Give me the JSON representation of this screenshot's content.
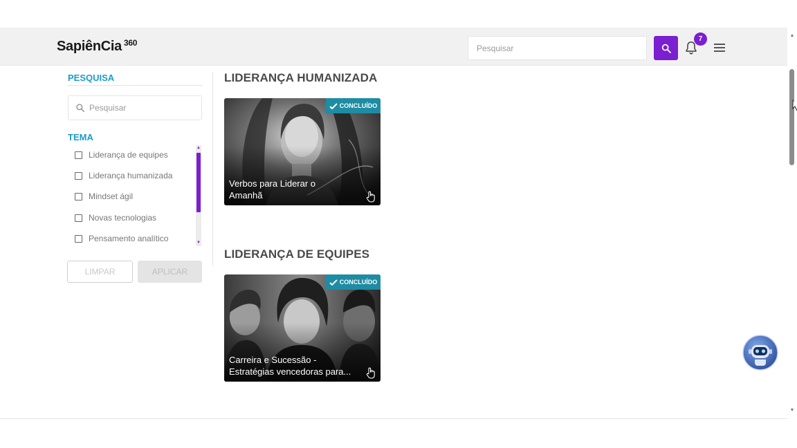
{
  "header": {
    "logo_text": "SapiênCia",
    "logo_sup": "360",
    "search_placeholder": "Pesquisar",
    "notification_count": "7",
    "accent_color": "#7b1fd1"
  },
  "sidebar": {
    "search_title": "PESQUISA",
    "search_placeholder": "Pesquisar",
    "tema_title": "TEMA",
    "tema_items": [
      {
        "label": "Liderança de equipes",
        "checked": false
      },
      {
        "label": "Liderança humanizada",
        "checked": false
      },
      {
        "label": "Mindset ágil",
        "checked": false
      },
      {
        "label": "Novas tecnologias",
        "checked": false
      },
      {
        "label": "Pensamento analítico",
        "checked": false
      }
    ],
    "clear_label": "LIMPAR",
    "apply_label": "APLICAR",
    "title_color": "#1b9bc8"
  },
  "sections": [
    {
      "title": "LIDERANÇA HUMANIZADA",
      "cards": [
        {
          "title": "Verbos para Liderar o\nAmanhã",
          "badge": "CONCLUÍDO"
        }
      ]
    },
    {
      "title": "LIDERANÇA DE EQUIPES",
      "cards": [
        {
          "title": "Carreira e Sucessão -\nEstratégias vencedoras para...",
          "badge": "CONCLUÍDO"
        }
      ]
    }
  ],
  "icons": {
    "search": "search-icon",
    "bell": "bell-icon",
    "menu": "hamburger-menu-icon",
    "check": "check-icon",
    "tap": "tap-hand-icon",
    "bot": "chatbot-robot-icon"
  }
}
